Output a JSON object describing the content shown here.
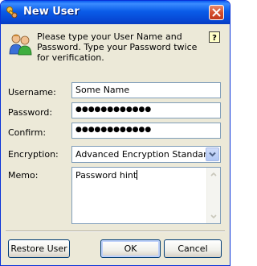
{
  "window": {
    "title": "New User",
    "icons": {
      "title": "key-user-icon",
      "close": "close-icon"
    }
  },
  "intro": {
    "icon": "users-icon",
    "text": "Please type your User Name and Password. Type your Password twice for verification.",
    "help_icon": "help-question-icon"
  },
  "form": {
    "username": {
      "label": "Username:",
      "value": "Some Name"
    },
    "password": {
      "label": "Password:",
      "value": "●●●●●●●●●●●●"
    },
    "confirm": {
      "label": "Confirm:",
      "value": "●●●●●●●●●●●●"
    },
    "encryption": {
      "label": "Encryption:",
      "value": "Advanced Encryption Standart"
    },
    "memo": {
      "label": "Memo:",
      "value": "Password hint"
    }
  },
  "buttons": {
    "restore": "Restore User",
    "ok": "OK",
    "cancel": "Cancel"
  },
  "colors": {
    "titlebar": "#0a5ce8",
    "dialog_bg": "#ece9d8",
    "field_border": "#7f9db9",
    "close_button": "#d4502f"
  }
}
